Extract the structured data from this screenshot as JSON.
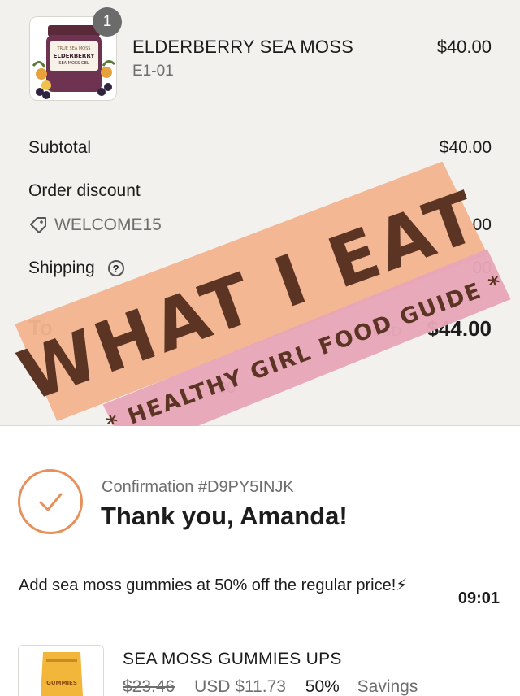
{
  "order_item": {
    "quantity": "1",
    "name": "ELDERBERRY SEA MOSS",
    "variant": "E1-01",
    "price": "$40.00",
    "jar_label_lines": [
      "TRUE SEA MOSS",
      "ELDERBERRY",
      "SEA MOSS GEL"
    ]
  },
  "summary": {
    "subtotal_label": "Subtotal",
    "subtotal_value": "$40.00",
    "discount_label": "Order discount",
    "discount_code": "WELCOME15",
    "discount_value_partial": ".00",
    "shipping_label": "Shipping",
    "shipping_help_glyph": "?",
    "shipping_value_partial": "00",
    "total_label_partial": "To",
    "total_currency": "USD",
    "total_value": "$44.00",
    "savings_partial": "00"
  },
  "overlay": {
    "headline": "WHAT I EAT",
    "subline": "* HEALTHY GIRL FOOD GUIDE *",
    "headline_bg": "#f2b48f",
    "subline_bg": "#e7a6b8",
    "text_color": "#5b3424"
  },
  "confirmation": {
    "number_text": "Confirmation #D9PY5INJK",
    "thank_you": "Thank you, Amanda!",
    "accent_color": "#e6915c"
  },
  "upsell": {
    "text": "Add sea moss gummies at 50% off the regular price!⚡",
    "time": "09:01",
    "product_name": "SEA MOSS GUMMIES UPS",
    "original_price": "$23.46",
    "sale_price": "USD $11.73",
    "discount_pct": "50%",
    "savings_label": "Savings",
    "pouch_label": "GUMMIES"
  }
}
